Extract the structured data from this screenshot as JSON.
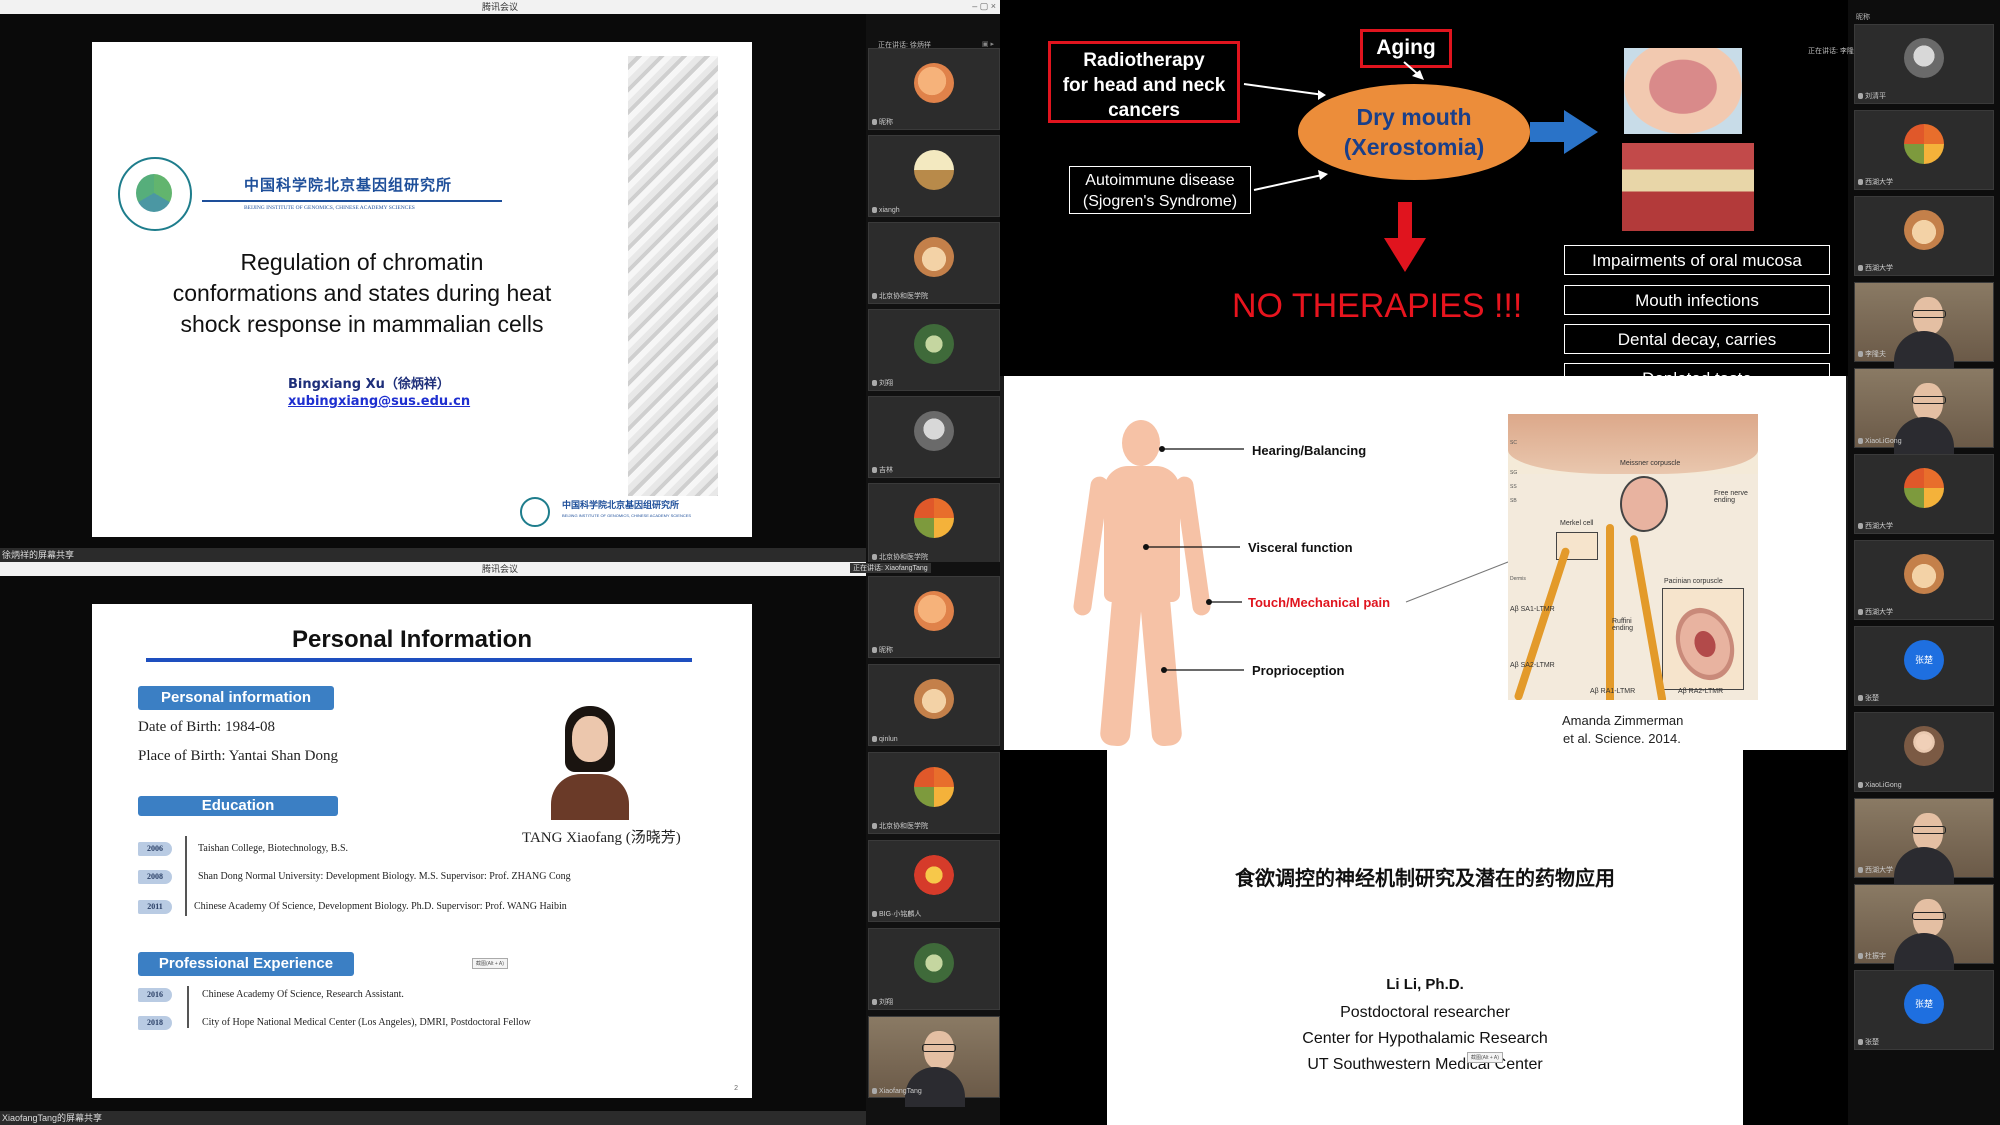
{
  "left_top": {
    "window_title": "腾讯会议",
    "share_label": "徐炳祥的屏幕共享",
    "slide": {
      "institute_cn": "中国科学院北京基因组研究所",
      "institute_en": "BEIJING INSTITUTE OF GENOMICS, CHINESE ACADEMY SCIENCES",
      "title_lines": [
        "Regulation of chromatin",
        "conformations and states during heat",
        "shock response in mammalian cells"
      ],
      "author": "Bingxiang Xu（徐炳祥）",
      "email": "xubingxiang@sus.edu.cn",
      "footer_cn": "中国科学院北京基因组研究所",
      "footer_en": "BEIJING INSTITUTE OF GENOMICS, CHINESE ACADEMY SCIENCES"
    },
    "strip_header": "正在讲话: 徐炳祥",
    "participants": [
      {
        "name": "昵称",
        "avatar": "av-orange"
      },
      {
        "name": "xiangh",
        "avatar": "av-beach"
      },
      {
        "name": "北京协和医学院",
        "avatar": "av-fox"
      },
      {
        "name": "刘翔",
        "avatar": "av-green"
      },
      {
        "name": "吉林",
        "avatar": "av-gray"
      },
      {
        "name": "北京协和医学院",
        "avatar": "av-tree"
      }
    ]
  },
  "left_bottom": {
    "window_title": "腾讯会议",
    "share_label": "XiaofangTang的屏幕共享",
    "strip_header": "正在讲话: XiaofangTang",
    "slide": {
      "heading": "Personal Information",
      "sec_personal": "Personal information",
      "dob": "Date of Birth: 1984-08",
      "pob": "Place of Birth: Yantai Shan Dong",
      "sec_education": "Education",
      "education": [
        {
          "year": "2006",
          "text": "Taishan College, Biotechnology, B.S."
        },
        {
          "year": "2008",
          "text": "Shan Dong Normal University: Development Biology.  M.S. Supervisor: Prof.  ZHANG Cong"
        },
        {
          "year": "2011",
          "text": "Chinese Academy Of  Science, Development Biology. Ph.D. Supervisor: Prof.  WANG Haibin"
        }
      ],
      "photo_caption": "TANG Xiaofang (汤晓芳)",
      "sec_professional": "Professional Experience",
      "professional": [
        {
          "year": "2016",
          "text": "Chinese Academy Of  Science, Research Assistant."
        },
        {
          "year": "2018",
          "text": "City of Hope National Medical Center (Los Angeles), DMRI, Postdoctoral Fellow"
        }
      ],
      "screenshot_tag": "截图(Alt + A)",
      "page_number": "2"
    },
    "participants": [
      {
        "name": "昵称",
        "avatar": "av-orange"
      },
      {
        "name": "qinlun",
        "avatar": "av-fox"
      },
      {
        "name": "北京协和医学院",
        "avatar": "av-tree"
      },
      {
        "name": "BIG·小铭麟人",
        "avatar": "av-tiger"
      },
      {
        "name": "刘翔",
        "avatar": "av-green"
      },
      {
        "name": "XiaofangTang",
        "avatar": "video"
      }
    ]
  },
  "right_top": {
    "boxes": {
      "radiotherapy": [
        "Radiotherapy",
        "for head and neck",
        "cancers"
      ],
      "aging": "Aging",
      "dry_mouth": [
        "Dry mouth",
        "(Xerostomia)"
      ],
      "autoimmune": [
        "Autoimmune disease",
        "(Sjogren's Syndrome)"
      ],
      "no_therapies": "NO THERAPIES !!!"
    },
    "list": [
      "Impairments of oral mucosa",
      "Mouth infections",
      "Dental decay, carries",
      "Depleted taste"
    ]
  },
  "right_mid": {
    "labels": [
      "Hearing/Balancing",
      "Visceral function",
      "Touch/Mechanical pain",
      "Proprioception"
    ],
    "citation": [
      "Amanda Zimmerman",
      "et al. Science. 2014."
    ],
    "figure_labels": {
      "meissner": "Meissner corpuscle",
      "free_nerve": "Free nerve ending",
      "merkel": "Merkel cell",
      "ruffini": "Ruffini ending",
      "pacinian": "Pacinian corpuscle",
      "sa1": "Aβ SA1-LTMR",
      "sa2": "Aβ SA2-LTMR",
      "ra1": "Aβ RA1-LTMR",
      "ra2": "Aβ RA2-LTMR",
      "side_labels": [
        "SC",
        "SG",
        "SS",
        "SB",
        "Dermis"
      ]
    }
  },
  "right_bottom": {
    "title_cn": "食欲调控的神经机制研究及潜在的药物应用",
    "name": "Li Li, Ph.D.",
    "lines": [
      "Postdoctoral researcher",
      "Center for Hypothalamic Research",
      "UT Southwestern Medical Center"
    ],
    "screenshot_tag": "截图(Alt + A)"
  },
  "right_strip": {
    "header": "正在讲话: 李隆夫",
    "participants": [
      {
        "name": "刘清平",
        "avatar": "av-gray"
      },
      {
        "name": "西湖大学",
        "avatar": "av-tree"
      },
      {
        "name": "西湖大学",
        "avatar": "av-fox"
      },
      {
        "name": "李隆夫",
        "avatar": "video"
      },
      {
        "name": "XiaoLiGong",
        "avatar": "video"
      },
      {
        "name": "西湖大学",
        "avatar": "av-tree"
      },
      {
        "name": "西湖大学",
        "avatar": "av-fox"
      },
      {
        "name": "张楚",
        "avatar": "av-blue",
        "label": "张楚"
      },
      {
        "name": "XiaoLiGong",
        "avatar": "av-person"
      },
      {
        "name": "西湖大学",
        "avatar": "video"
      },
      {
        "name": "杜振宇",
        "avatar": "video"
      },
      {
        "name": "张楚",
        "avatar": "av-blue",
        "label": "张楚"
      }
    ],
    "group_labels": [
      "昵称",
      "昵称"
    ]
  }
}
